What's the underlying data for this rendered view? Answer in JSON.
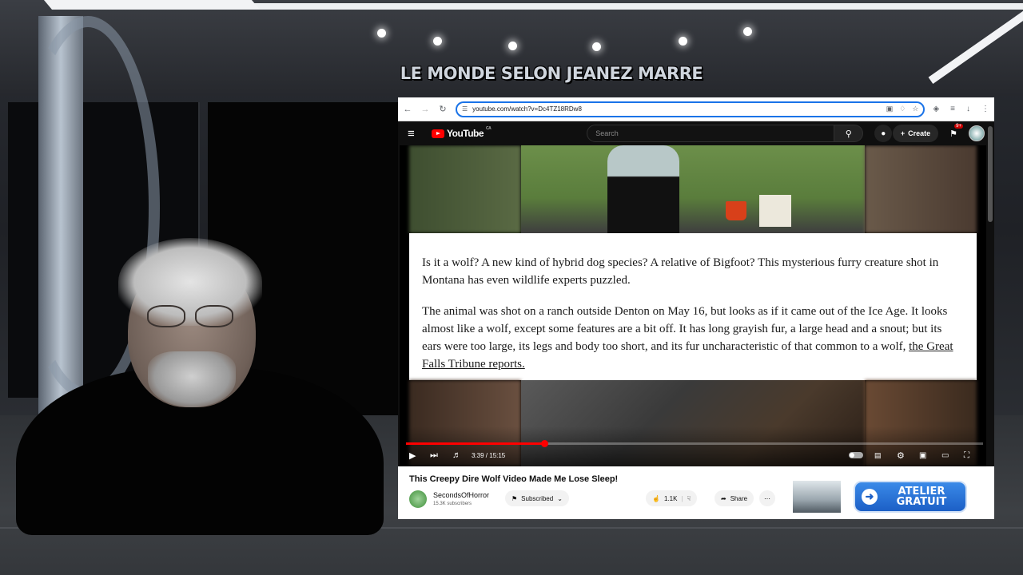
{
  "overlay": {
    "brand_title": "LE MONDE SELON JEANEZ MARRE"
  },
  "browser": {
    "url": "youtube.com/watch?v=Dc4TZ18RDw8",
    "back_icon": "arrow-left-icon",
    "forward_icon": "arrow-right-icon",
    "reload_icon": "reload-icon"
  },
  "youtube": {
    "logo_text": "YouTube",
    "region": "CA",
    "search_placeholder": "Search",
    "create_label": "Create",
    "notification_count": "9+"
  },
  "player": {
    "current_time": "3:39",
    "duration": "15:15",
    "time_display": "3:39 / 15:15",
    "progress_fraction": 0.24
  },
  "article": {
    "paragraph1": "Is it a wolf? A new kind of hybrid dog species? A relative of Bigfoot? This mysterious furry creature shot in Montana has even wildlife experts puzzled.",
    "paragraph2": "The animal was shot on a ranch outside Denton on May 16, but looks as if it came out of the Ice Age. It looks almost like a wolf, except some features are a bit off. It has long grayish fur, a large head and a snout; but its ears were too large, its legs and body too short, and its fur uncharacteristic of that common to a wolf, ",
    "link_text": "the Great Falls Tribune reports."
  },
  "video": {
    "title": "This Creepy Dire Wolf Video Made Me Lose Sleep!",
    "channel_name": "SecondsOfHorror",
    "subscribers": "15.3K subscribers",
    "subscribed_label": "Subscribed",
    "like_count": "1.1K",
    "share_label": "Share"
  },
  "cta": {
    "line1": "ATELIER",
    "line2": "GRATUIT"
  }
}
